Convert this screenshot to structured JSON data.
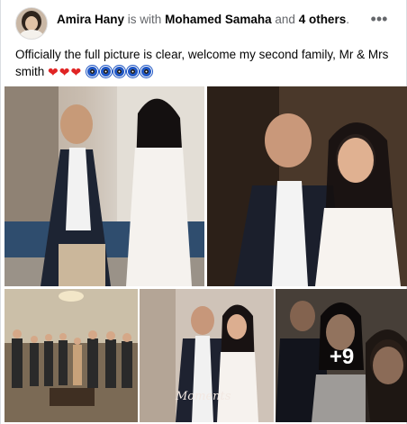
{
  "post": {
    "author": "Amira Hany",
    "with_text": "is with",
    "tagged_person": "Mohamed Samaha",
    "and_text": "and",
    "others": "4 others",
    "suffix": ".",
    "caption": "Officially the full picture is clear, welcome my second family, Mr & Mrs smith",
    "emoji": [
      "red-heart",
      "red-heart",
      "red-heart",
      "nazar-amulet",
      "nazar-amulet",
      "nazar-amulet",
      "nazar-amulet",
      "nazar-amulet"
    ],
    "more_options_icon": "more-horizontal-icon",
    "more_photos_count": "+9",
    "watermark": "Moments"
  },
  "colors": {
    "name": "#050505",
    "secondary_text": "#65676b",
    "heart": "#e02424",
    "nazar_blue": "#1f56c4"
  }
}
